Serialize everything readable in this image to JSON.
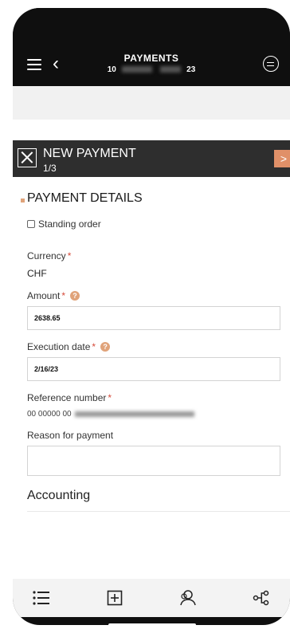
{
  "topbar": {
    "title": "PAYMENTS",
    "subtitle_prefix": "10",
    "subtitle_suffix": "23"
  },
  "header": {
    "title": "NEW PAYMENT",
    "step": "1/3",
    "next_glyph": ">"
  },
  "section": {
    "title": "PAYMENT DETAILS"
  },
  "form": {
    "standing_order_label": "Standing order",
    "currency_label": "Currency",
    "currency_value": "CHF",
    "amount_label": "Amount",
    "amount_value": "2638.65",
    "execution_label": "Execution date",
    "execution_value": "2/16/23",
    "reference_label": "Reference number",
    "reference_value_prefix": "00 00000 00",
    "reason_label": "Reason for payment",
    "reason_value": "",
    "required_mark": "*",
    "help_glyph": "?"
  },
  "accounting": {
    "title": "Accounting"
  },
  "nav": {
    "items": [
      "list-icon",
      "add-icon",
      "contacts-icon",
      "share-icon"
    ]
  }
}
